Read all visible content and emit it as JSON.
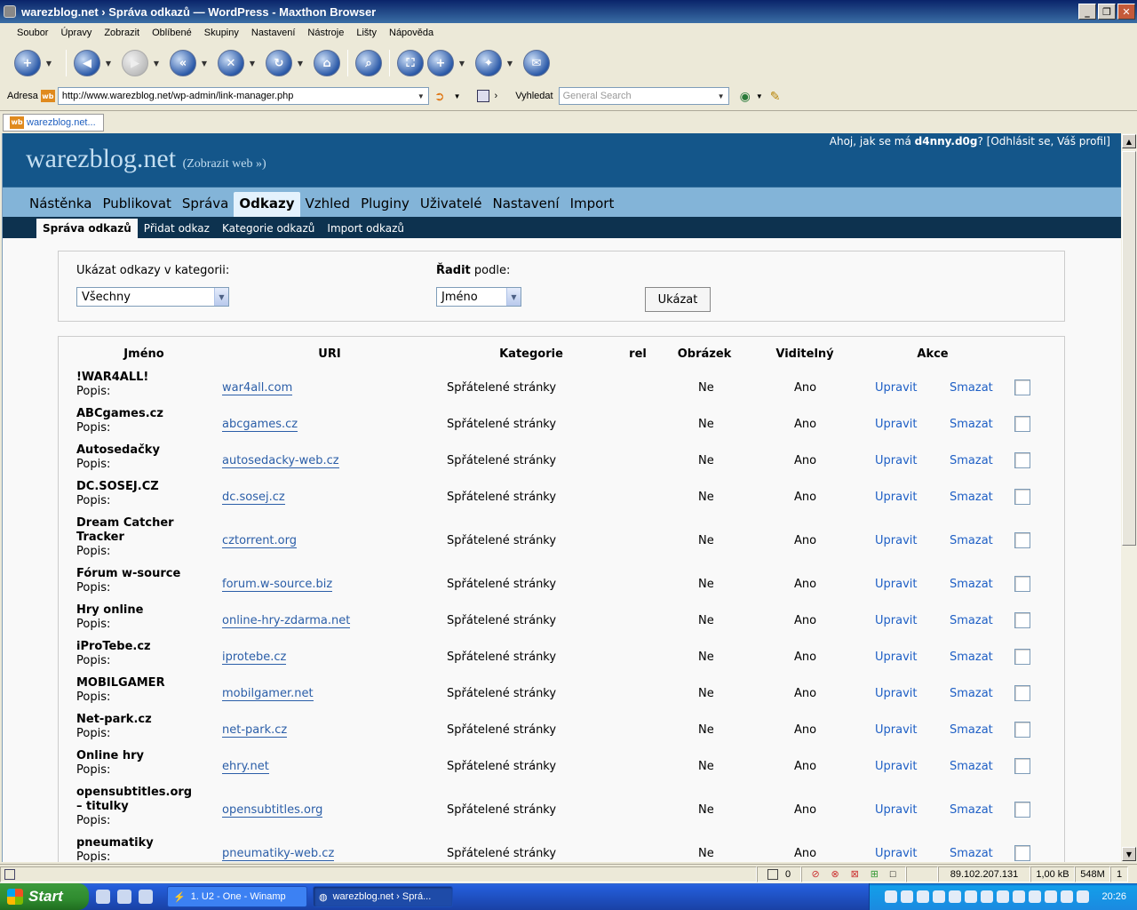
{
  "window": {
    "title": "warezblog.net › Správa odkazů — WordPress - Maxthon Browser"
  },
  "menu": [
    "Soubor",
    "Úpravy",
    "Zobrazit",
    "Oblíbené",
    "Skupiny",
    "Nastavení",
    "Nástroje",
    "Lišty",
    "Nápověda"
  ],
  "address": {
    "label": "Adresa",
    "url": "http://www.warezblog.net/wp-admin/link-manager.php",
    "favicon": "wb"
  },
  "search": {
    "label": "Vyhledat",
    "placeholder": "General Search"
  },
  "tab": {
    "label": "warezblog.net..."
  },
  "wp": {
    "blogname": "warezblog.net",
    "view_site": "(Zobrazit web »)",
    "greeting": "Ahoj, jak se má",
    "user": "d4nny.d0g",
    "user_links": "? [Odhlásit se, Váš profil]",
    "admin_menu": [
      {
        "label": "Nástěnka"
      },
      {
        "label": "Publikovat"
      },
      {
        "label": "Správa"
      },
      {
        "label": "Odkazy",
        "active": true
      },
      {
        "label": "Vzhled"
      },
      {
        "label": "Pluginy"
      },
      {
        "label": "Uživatelé"
      },
      {
        "label": "Nastavení"
      },
      {
        "label": "Import"
      }
    ],
    "sub_menu": [
      {
        "label": "Správa odkazů",
        "active": true
      },
      {
        "label": "Přidat odkaz"
      },
      {
        "label": "Kategorie odkazů"
      },
      {
        "label": "Import odkazů"
      }
    ]
  },
  "filter": {
    "category_label": "Ukázat odkazy v kategorii:",
    "category_value": "Všechny",
    "order_label_bold": "Řadit",
    "order_label_rest": " podle:",
    "order_value": "Jméno",
    "button": "Ukázat"
  },
  "table": {
    "headers": {
      "name": "Jméno",
      "uri": "URI",
      "category": "Kategorie",
      "rel": "rel",
      "image": "Obrázek",
      "visible": "Viditelný",
      "actions": "Akce"
    },
    "desc_label": "Popis:",
    "edit_label": "Upravit",
    "delete_label": "Smazat",
    "rows": [
      {
        "name": "!WAR4ALL!",
        "uri": "war4all.com",
        "category": "Spřátelené stránky",
        "image": "Ne",
        "visible": "Ano"
      },
      {
        "name": "ABCgames.cz",
        "uri": "abcgames.cz",
        "category": "Spřátelené stránky",
        "image": "Ne",
        "visible": "Ano"
      },
      {
        "name": "Autosedačky",
        "uri": "autosedacky-web.cz",
        "category": "Spřátelené stránky",
        "image": "Ne",
        "visible": "Ano"
      },
      {
        "name": "DC.SOSEJ.CZ",
        "uri": "dc.sosej.cz",
        "category": "Spřátelené stránky",
        "image": "Ne",
        "visible": "Ano"
      },
      {
        "name": "Dream Catcher Tracker",
        "uri": "cztorrent.org",
        "category": "Spřátelené stránky",
        "image": "Ne",
        "visible": "Ano"
      },
      {
        "name": "Fórum w-source",
        "uri": "forum.w-source.biz",
        "category": "Spřátelené stránky",
        "image": "Ne",
        "visible": "Ano"
      },
      {
        "name": "Hry online",
        "uri": "online-hry-zdarma.net",
        "category": "Spřátelené stránky",
        "image": "Ne",
        "visible": "Ano"
      },
      {
        "name": "iProTebe.cz",
        "uri": "iprotebe.cz",
        "category": "Spřátelené stránky",
        "image": "Ne",
        "visible": "Ano"
      },
      {
        "name": "MOBILGAMER",
        "uri": "mobilgamer.net",
        "category": "Spřátelené stránky",
        "image": "Ne",
        "visible": "Ano"
      },
      {
        "name": "Net-park.cz",
        "uri": "net-park.cz",
        "category": "Spřátelené stránky",
        "image": "Ne",
        "visible": "Ano"
      },
      {
        "name": "Online hry",
        "uri": "ehry.net",
        "category": "Spřátelené stránky",
        "image": "Ne",
        "visible": "Ano"
      },
      {
        "name": "opensubtitles.org – titulky",
        "uri": "opensubtitles.org",
        "category": "Spřátelené stránky",
        "image": "Ne",
        "visible": "Ano"
      },
      {
        "name": "pneumatiky",
        "uri": "pneumatiky-web.cz",
        "category": "Spřátelené stránky",
        "image": "Ne",
        "visible": "Ano"
      }
    ]
  },
  "status": {
    "count": "0",
    "ip": "89.102.207.131",
    "size": "1,00 kB",
    "memory": "548M",
    "page": "1"
  },
  "taskbar": {
    "start": "Start",
    "tasks": [
      {
        "label": "1. U2 - One - Winamp"
      },
      {
        "label": "warezblog.net › Sprá..."
      }
    ],
    "clock": "20:26"
  },
  "colors": {
    "wp_header": "#14568a",
    "wp_menu": "#83b4d8",
    "wp_submenu": "#0d324f",
    "link": "#2b5ea8"
  }
}
